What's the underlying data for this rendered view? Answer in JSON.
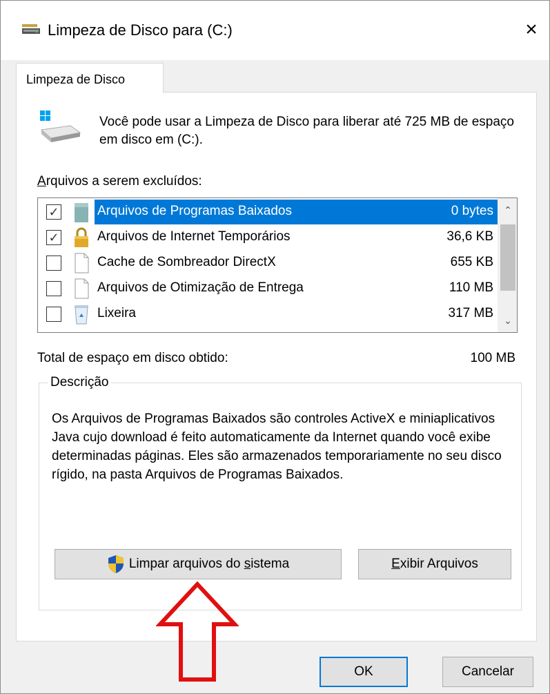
{
  "window": {
    "title": "Limpeza de Disco para  (C:)",
    "close_icon": "×"
  },
  "tab": {
    "label": "Limpeza de Disco"
  },
  "intro": {
    "text": "Você pode usar a Limpeza de Disco para liberar até 725 MB de espaço em disco em  (C:)."
  },
  "files_label": {
    "first": "A",
    "rest": "rquivos a serem excluídos:"
  },
  "files": [
    {
      "name": "Arquivos de Programas Baixados",
      "size": "0 bytes",
      "checked": true,
      "selected": true,
      "icon": "downloaded-programs-icon"
    },
    {
      "name": "Arquivos de Internet Temporários",
      "size": "36,6 KB",
      "checked": true,
      "selected": false,
      "icon": "lock-icon"
    },
    {
      "name": "Cache de Sombreador DirectX",
      "size": "655 KB",
      "checked": false,
      "selected": false,
      "icon": "blank-file-icon"
    },
    {
      "name": "Arquivos de Otimização de Entrega",
      "size": "110 MB",
      "checked": false,
      "selected": false,
      "icon": "blank-file-icon"
    },
    {
      "name": "Lixeira",
      "size": "317 MB",
      "checked": false,
      "selected": false,
      "icon": "recycle-bin-icon"
    }
  ],
  "total": {
    "label": "Total de espaço em disco obtido:",
    "value": "100 MB"
  },
  "description": {
    "legend": "Descrição",
    "text": "Os Arquivos de Programas Baixados são controles ActiveX e miniaplicativos Java cujo download é feito automaticamente da Internet quando você exibe determinadas páginas. Eles são armazenados temporariamente no seu disco rígido, na pasta Arquivos de Programas Baixados."
  },
  "buttons": {
    "clean_system_pre": "Limpar arquivos do ",
    "clean_system_u": "s",
    "clean_system_post": "istema",
    "view_u": "E",
    "view_post": "xibir Arquivos",
    "ok": "OK",
    "cancel": "Cancelar"
  },
  "colors": {
    "selection": "#0078d7",
    "annotation_arrow": "#e01010"
  }
}
